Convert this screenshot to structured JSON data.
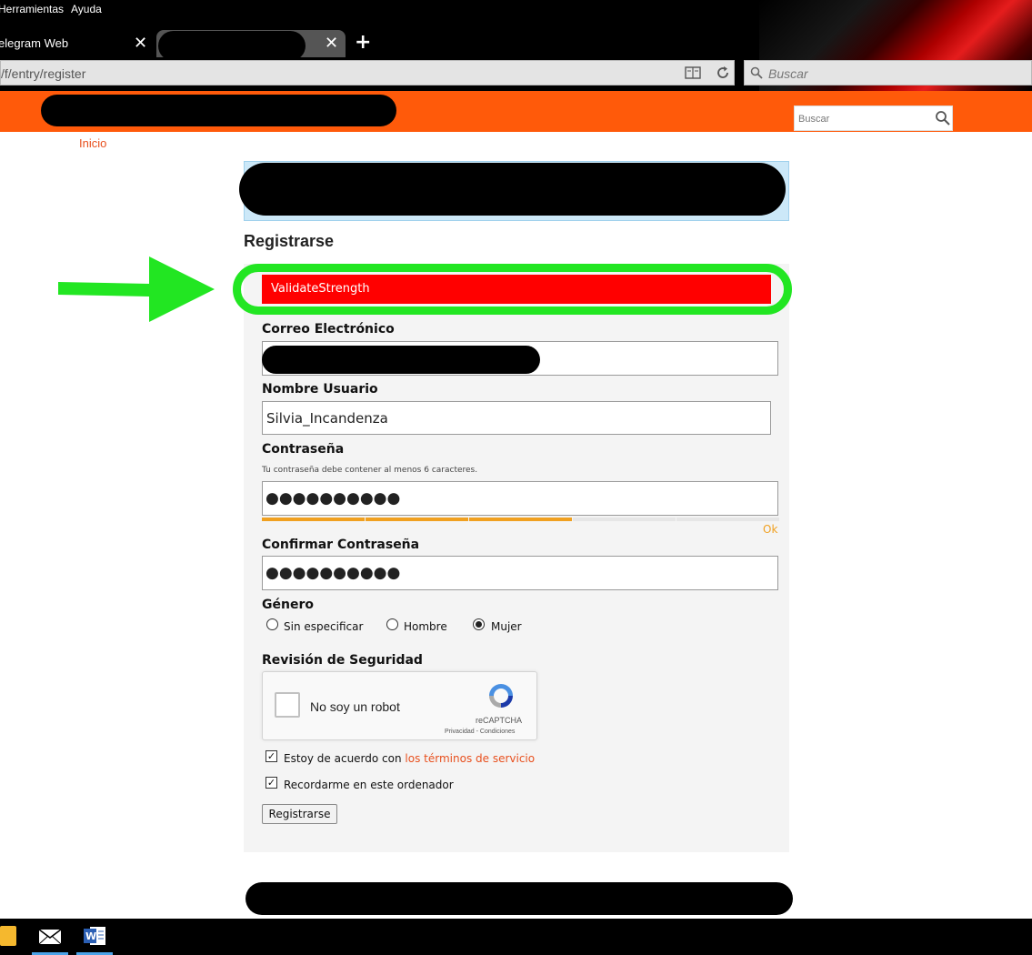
{
  "browser": {
    "menu": [
      "Herramientas",
      "Ayuda"
    ],
    "tabs": [
      {
        "label": "elegram Web"
      },
      {
        "label": ""
      }
    ],
    "url": "/f/entry/register",
    "search_placeholder": "Buscar"
  },
  "site": {
    "search_placeholder": "Buscar",
    "breadcrumb": "Inicio"
  },
  "form": {
    "title": "Registrarse",
    "error": "ValidateStrength",
    "email_label": "Correo Electrónico",
    "username_label": "Nombre Usuario",
    "username_value": "Silvia_Incandenza",
    "password_label": "Contraseña",
    "password_hint": "Tu contraseña debe contener al menos 6 caracteres.",
    "password_masked": "●●●●●●●●●●",
    "strength_text": "Ok",
    "strength_level": 0.6,
    "confirm_label": "Confirmar Contraseña",
    "confirm_masked": "●●●●●●●●●●",
    "gender_label": "Género",
    "gender_options": [
      "Sin especificar",
      "Hombre",
      "Mujer"
    ],
    "gender_selected": "Mujer",
    "security_label": "Revisión de Seguridad",
    "captcha_text": "No soy un robot",
    "captcha_brand": "reCAPTCHA",
    "captcha_links": "Privacidad - Condiciones",
    "terms_prefix": "Estoy de acuerdo con",
    "terms_link": "los términos de servicio",
    "remember_label": "Recordarme en este ordenador",
    "submit_label": "Registrarse"
  },
  "colors": {
    "header": "#ff5a0a",
    "accent": "#e8501e",
    "error": "#ff0000",
    "highlight": "#22e622",
    "strength": "#f0a020"
  },
  "icons": [
    "close-icon",
    "plus-icon",
    "reader-icon",
    "reload-icon",
    "search-icon",
    "arrow-icon",
    "recaptcha-icon",
    "folder-icon",
    "mail-icon",
    "word-icon"
  ]
}
